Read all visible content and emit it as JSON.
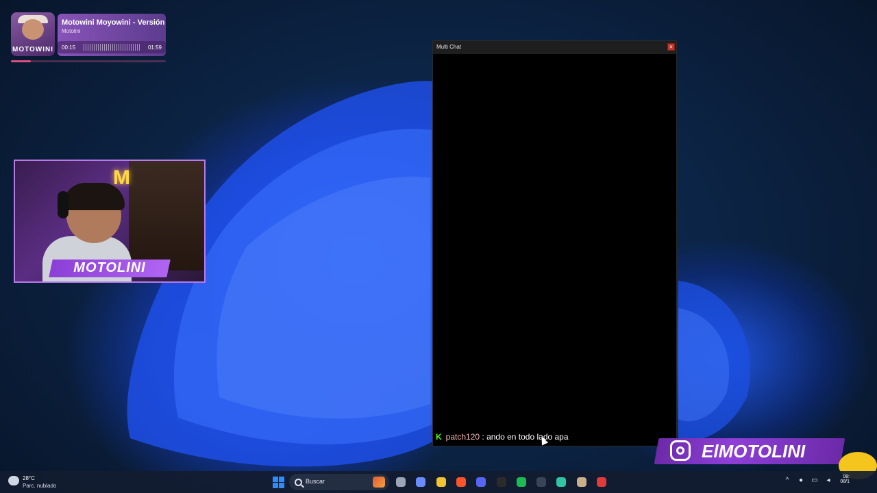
{
  "now_playing": {
    "title": "Motowini Moyowini - Versión",
    "artist": "Motolini",
    "current_time": "00:15",
    "duration": "01:59",
    "cover_text": "MOTOWINI",
    "progress_fraction": 0.13
  },
  "webcam": {
    "name": "MOTOLINI",
    "neon_sign": "M"
  },
  "chat_window": {
    "title": "Multi Chat",
    "close_label": "×",
    "messages": [
      {
        "platform_badge": "K",
        "username": "patch120",
        "separator": " : ",
        "text": "ando en todo lado apa"
      }
    ]
  },
  "instagram": {
    "handle": "ElMOTOLINI"
  },
  "taskbar": {
    "weather_temp": "28°C",
    "weather_desc": "Parc. nublado",
    "search_placeholder": "Buscar",
    "pinned": [
      {
        "name": "file-explorer-icon",
        "color": "#9aa5b8"
      },
      {
        "name": "copilot-icon",
        "color": "#6a8cff"
      },
      {
        "name": "folder-icon",
        "color": "#f1c232"
      },
      {
        "name": "brave-browser-icon",
        "color": "#fb542b"
      },
      {
        "name": "discord-icon",
        "color": "#5865f2"
      },
      {
        "name": "terminal-icon",
        "color": "#2b2b2b"
      },
      {
        "name": "spotify-icon",
        "color": "#1db954"
      },
      {
        "name": "audio-mixer-icon",
        "color": "#3a4458"
      },
      {
        "name": "streamlabs-icon",
        "color": "#31c3a2"
      },
      {
        "name": "active-app-icon",
        "color": "#c8b08a"
      },
      {
        "name": "red-app-icon",
        "color": "#e03a3a"
      }
    ],
    "clock_time": "08:",
    "clock_date": "08/1"
  }
}
